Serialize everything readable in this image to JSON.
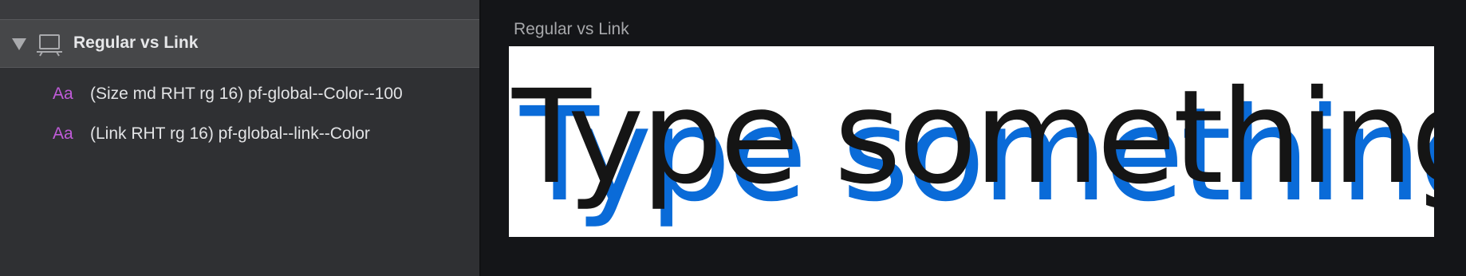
{
  "sidebar": {
    "group": {
      "label": "Regular vs Link",
      "icon": "artboard-icon",
      "expanded": true
    },
    "items": [
      {
        "icon_text": "Aa",
        "label": "(Size md RHT rg 16) pf-global--Color--100"
      },
      {
        "icon_text": "Aa",
        "label": "(Link RHT rg 16) pf-global--link--Color"
      }
    ]
  },
  "canvas": {
    "artboard_title": "Regular vs Link",
    "sample_text_regular": "Type something",
    "sample_text_link": "Type something"
  },
  "colors": {
    "sidebar_bg": "#2f3033",
    "selected_row_bg": "#464749",
    "canvas_bg": "#141518",
    "text_style_icon": "#c05bd9",
    "regular_text": "#151515",
    "link_text": "#0a6bd8"
  }
}
